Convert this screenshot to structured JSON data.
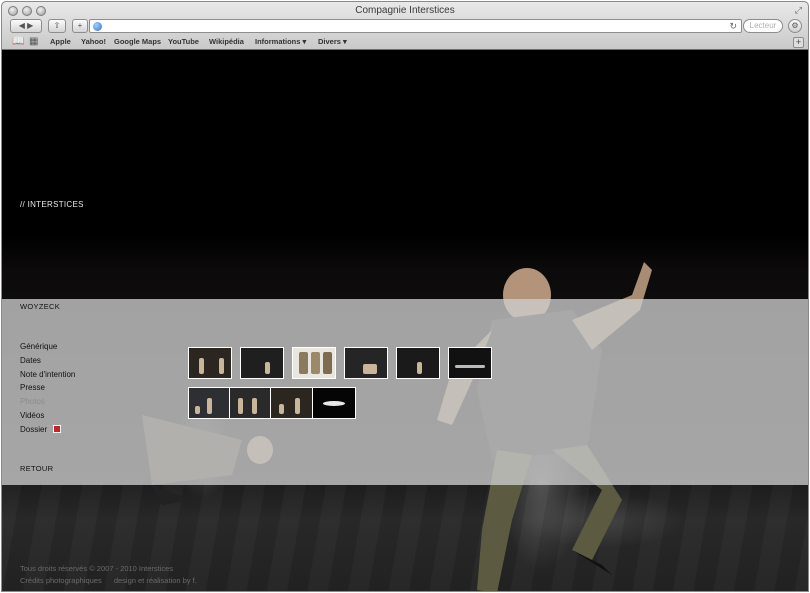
{
  "browser": {
    "title": "Compagnie Interstices",
    "search_placeholder": "Lecteur",
    "bookmarks": [
      "Apple",
      "Yahoo!",
      "Google Maps",
      "YouTube",
      "Wikipédia",
      "Informations ▾",
      "Divers ▾"
    ]
  },
  "page": {
    "site_title": "// INTERSTICES",
    "section_title": "WOYZECK",
    "menu": [
      "Générique",
      "Dates",
      "Note d'intention",
      "Presse",
      "Photos",
      "Vidéos",
      "Dossier"
    ],
    "active_menu": "Photos",
    "back_link": "RETOUR",
    "footer_copyright": "Tous droits réservés © 2007 - 2010 Interstices",
    "footer_credits": "Crédits photographiques",
    "footer_design": "design et réalisation by f."
  },
  "colors": {
    "panel": "#cdcdcd",
    "active_menu": "#8c8c8c",
    "background": "#000000"
  },
  "icons": {
    "pdf": "pdf-icon"
  }
}
